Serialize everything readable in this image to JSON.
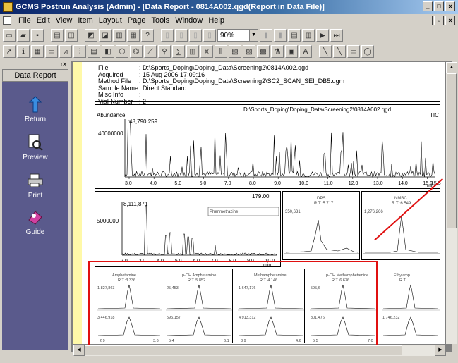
{
  "window": {
    "title": "GCMS Postrun Analysis (Admin) - [Data Report - 0814A002.qgd(Report in Data File)]"
  },
  "menu": [
    "File",
    "Edit",
    "View",
    "Item",
    "Layout",
    "Page",
    "Tools",
    "Window",
    "Help"
  ],
  "toolbar": {
    "zoom": "90%"
  },
  "sidebar": {
    "title": "Data Report",
    "items": [
      {
        "label": "Return",
        "icon": "return-arrow-icon"
      },
      {
        "label": "Preview",
        "icon": "preview-icon"
      },
      {
        "label": "Print",
        "icon": "print-icon"
      },
      {
        "label": "Guide",
        "icon": "guide-icon"
      }
    ]
  },
  "info": [
    {
      "k": "File",
      "v": ": D:\\Sports_Doping\\Doping_Data\\Screening2\\0814A002.qgd"
    },
    {
      "k": "Acquired",
      "v": ": 15 Aug 2006 17:09:16"
    },
    {
      "k": "Method File",
      "v": ": D:\\Sports_Doping\\Doping_Data\\Screening2\\SC2_SCAN_SEI_DB5.qgm"
    },
    {
      "k": "Sample Name",
      "v": ": Direct Standard"
    },
    {
      "k": "Misc Info",
      "v": ":"
    },
    {
      "k": "Vial Number",
      "v": ": 2"
    }
  ],
  "tic": {
    "path": "D:\\Sports_Doping\\Doping_Data\\Screening2\\0814A002.qgd",
    "ylabel": "Abundance",
    "tag": "TIC",
    "peak_label": "48,790,259",
    "ytick": "40000000",
    "xticks": [
      "3.0",
      "4.0",
      "5.0",
      "6.0",
      "7.0",
      "8.0",
      "9.0",
      "10.0",
      "11.0",
      "12.0",
      "13.0",
      "14.0",
      "15.0"
    ],
    "xend": "15.5",
    "unit": "min"
  },
  "sub": {
    "top_right": "179.00",
    "peak_label": "8,111,871",
    "ytick": "5000000",
    "box_label": "Phenmetrazine",
    "xticks": [
      "2.0",
      "3.0",
      "4.0",
      "5.0",
      "6.0",
      "7.0",
      "8.0",
      "9.0",
      "10.0"
    ],
    "unit": "min"
  },
  "mini_top": [
    {
      "name": "DPS",
      "rt": "R.T.:5.717",
      "val": "350,631"
    },
    {
      "name": "NMBC",
      "rt": "R.T.:6.549",
      "val": "1,276,266"
    }
  ],
  "mini_bottom": [
    {
      "name": "Amphetamine",
      "rt": "R.T.:3.336",
      "v1": "1,827,863",
      "v2": "3,446,918",
      "x1": "2.9",
      "x2": "3.6"
    },
    {
      "name": "p-OH Amphetamine",
      "rt": "R.T.:5.852",
      "v1": "25,453",
      "v2": "595,157",
      "x1": "5.4",
      "x2": "6.1"
    },
    {
      "name": "Methamphetamine",
      "rt": "R.T.:4.146",
      "v1": "1,647,176",
      "v2": "4,913,312",
      "x1": "3.9",
      "x2": "4.6"
    },
    {
      "name": "p-OH Methamphetamine",
      "rt": "R.T.:6.636",
      "v1": "595,6",
      "v2": "301,476",
      "x1": "5.5",
      "x2": "7.0"
    },
    {
      "name": "Ethylamp",
      "rt": "R.T.",
      "v1": "",
      "v2": "1,746,232",
      "x1": "",
      "x2": ""
    }
  ],
  "colors": {
    "sidebar": "#5a5a8c",
    "highlight": "#e01010",
    "title": "#0a246a"
  }
}
